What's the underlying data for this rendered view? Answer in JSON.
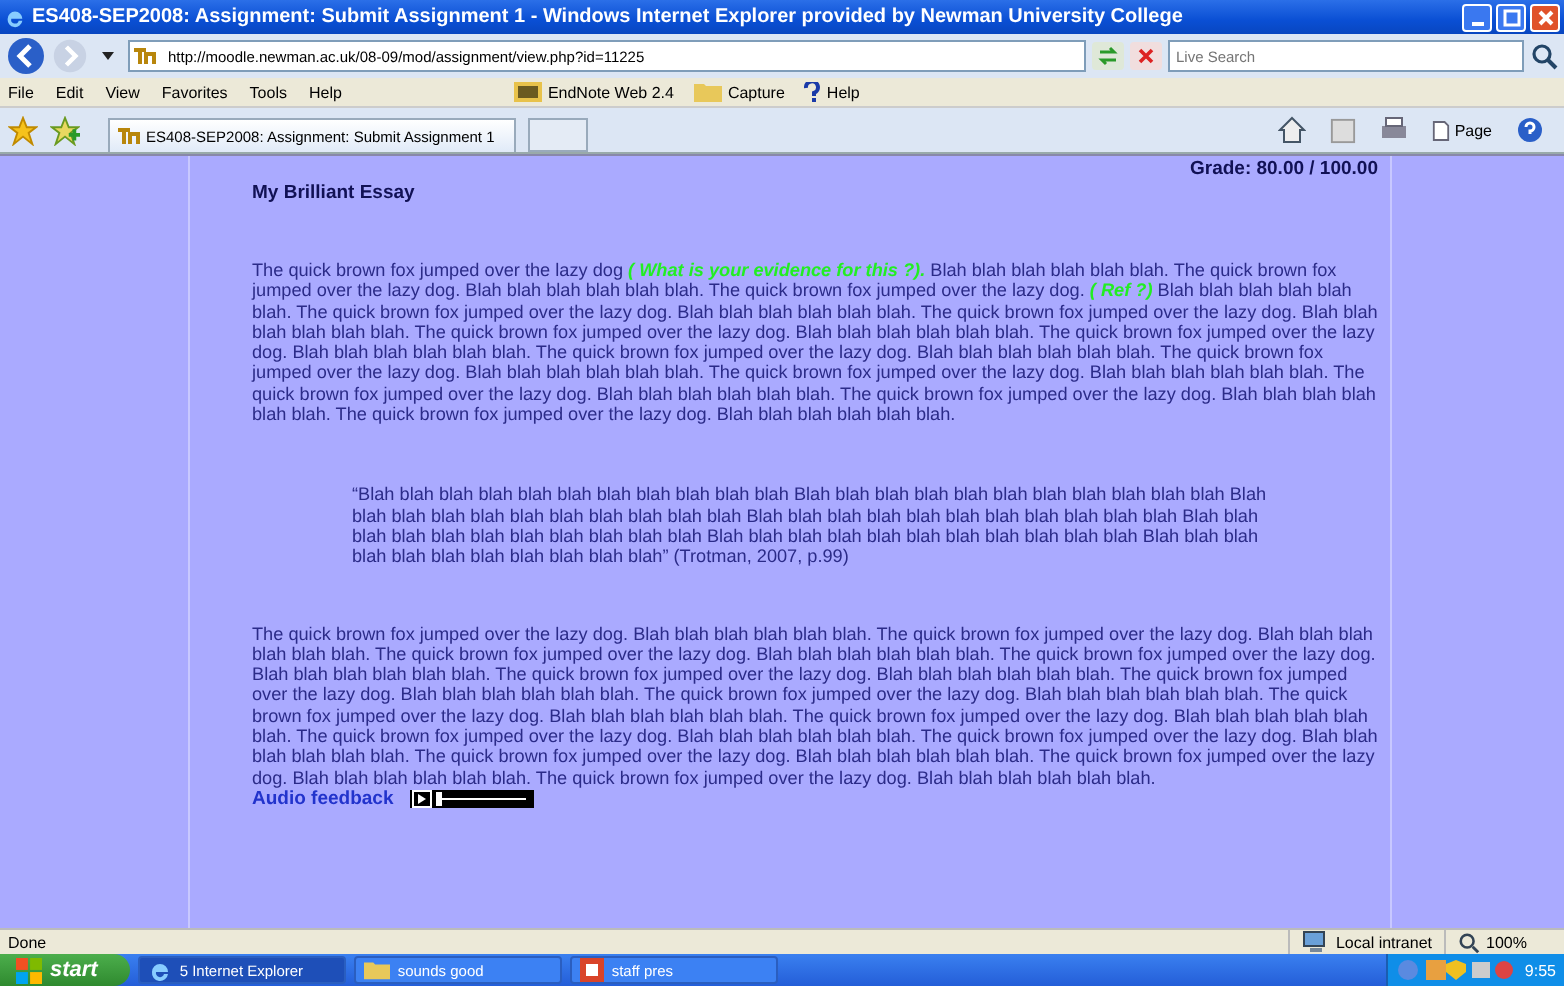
{
  "window": {
    "title": "ES408-SEP2008: Assignment: Submit Assignment 1 - Windows Internet Explorer provided by Newman University College"
  },
  "address_bar": {
    "url": "http://moodle.newman.ac.uk/08-09/mod/assignment/view.php?id=11225",
    "search_placeholder": "Live Search"
  },
  "menu": [
    "File",
    "Edit",
    "View",
    "Favorites",
    "Tools",
    "Help"
  ],
  "links": [
    {
      "kind": "endnote",
      "label": "EndNote Web 2.4"
    },
    {
      "kind": "folder",
      "label": "Capture"
    },
    {
      "kind": "help",
      "label": "Help"
    }
  ],
  "tab": {
    "title": "ES408-SEP2008: Assignment: Submit Assignment 1"
  },
  "command_bar": {
    "page": "Page"
  },
  "page": {
    "grade": "Grade: 80.00 / 100.00",
    "heading": "My Brilliant Essay",
    "paragraphs": [
      {
        "kind": "body",
        "text": "The quick brown fox jumped over the lazy dog **( What is your evidence for this ?).** Blah blah blah blah blah blah. The quick brown fox jumped over the lazy dog. Blah blah blah blah blah blah. The quick brown fox jumped over the lazy dog. **( Ref ?)** Blah blah blah blah blah blah. The quick brown fox jumped over the lazy dog. Blah blah blah blah blah blah. The quick brown fox jumped over the lazy dog. Blah blah blah blah blah blah. The quick brown fox jumped over the lazy dog. Blah blah blah blah blah blah. The quick brown fox jumped over the lazy dog. Blah blah blah blah blah blah. The quick brown fox jumped over the lazy dog. Blah blah blah blah blah blah. The quick brown fox jumped over the lazy dog. Blah blah blah blah blah blah. The quick brown fox jumped over the lazy dog. Blah blah blah blah blah blah. The quick brown fox jumped over the lazy dog. Blah blah blah blah blah blah. The quick brown fox jumped over the lazy dog. Blah blah blah blah blah blah. The quick brown fox jumped over the lazy dog. Blah blah blah blah blah blah."
      },
      {
        "kind": "quote",
        "text": "“Blah blah blah blah blah blah blah blah blah blah blah Blah blah blah blah blah blah blah blah blah blah blah Blah blah blah blah blah blah blah blah blah blah blah Blah blah blah blah blah blah blah blah blah blah blah Blah blah blah blah blah blah blah blah blah blah blah Blah blah blah blah blah blah blah blah blah blah blah Blah blah blah blah blah blah blah blah blah blah blah” (Trotman, 2007, p.99)"
      },
      {
        "kind": "body",
        "text": "The quick brown fox jumped over the lazy dog. Blah blah blah blah blah blah. The quick brown fox jumped over the lazy dog. Blah blah blah blah blah blah. The quick brown fox jumped over the lazy dog. Blah blah blah blah blah blah. The quick brown fox jumped over the lazy dog. Blah blah blah blah blah blah. The quick brown fox jumped over the lazy dog. Blah blah blah blah blah blah. The quick brown fox jumped over the lazy dog. Blah blah blah blah blah blah. The quick brown fox jumped over the lazy dog. Blah blah blah blah blah blah. The quick brown fox jumped over the lazy dog. Blah blah blah blah blah blah. The quick brown fox jumped over the lazy dog. Blah blah blah blah blah blah. The quick brown fox jumped over the lazy dog. Blah blah blah blah blah blah. The quick brown fox jumped over the lazy dog. Blah blah blah blah blah blah. The quick brown fox jumped over the lazy dog. Blah blah blah blah blah blah. The quick brown fox jumped over the lazy dog. Blah blah blah blah blah blah. The quick brown fox jumped over the lazy dog. Blah blah blah blah blah blah."
      }
    ],
    "audio": {
      "label": "Audio feedback",
      "level": 0
    }
  },
  "status_bar": {
    "text": "Done",
    "zone": "Local intranet",
    "zoom": "100%"
  },
  "taskbar": {
    "start": "start",
    "tasks": [
      {
        "kind": "ie",
        "label": "5 Internet Explorer",
        "selected": true
      },
      {
        "kind": "folder",
        "label": "sounds good",
        "selected": false
      },
      {
        "kind": "ppt",
        "label": "staff pres",
        "selected": false
      }
    ],
    "clock": "9:55"
  }
}
